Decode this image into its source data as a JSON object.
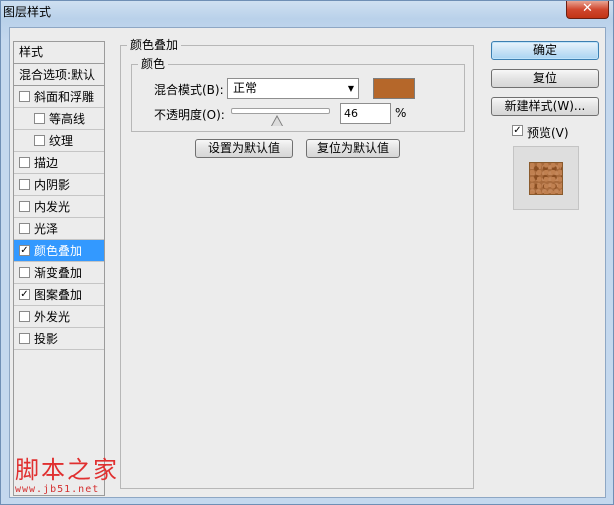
{
  "window": {
    "title": "图层样式",
    "close_glyph": "✕"
  },
  "left_list": {
    "header": "样式",
    "blend_options": "混合选项:默认",
    "items": [
      {
        "label": "斜面和浮雕",
        "checked": false,
        "sub": false,
        "selected": false
      },
      {
        "label": "等高线",
        "checked": false,
        "sub": true,
        "selected": false
      },
      {
        "label": "纹理",
        "checked": false,
        "sub": true,
        "selected": false
      },
      {
        "label": "描边",
        "checked": false,
        "sub": false,
        "selected": false
      },
      {
        "label": "内阴影",
        "checked": false,
        "sub": false,
        "selected": false
      },
      {
        "label": "内发光",
        "checked": false,
        "sub": false,
        "selected": false
      },
      {
        "label": "光泽",
        "checked": false,
        "sub": false,
        "selected": false
      },
      {
        "label": "颜色叠加",
        "checked": true,
        "sub": false,
        "selected": true
      },
      {
        "label": "渐变叠加",
        "checked": false,
        "sub": false,
        "selected": false
      },
      {
        "label": "图案叠加",
        "checked": true,
        "sub": false,
        "selected": false
      },
      {
        "label": "外发光",
        "checked": false,
        "sub": false,
        "selected": false
      },
      {
        "label": "投影",
        "checked": false,
        "sub": false,
        "selected": false
      }
    ]
  },
  "color_overlay": {
    "group_title": "颜色叠加",
    "color_group_title": "颜色",
    "blend_mode_label": "混合模式(B):",
    "blend_mode_value": "正常",
    "overlay_color": "#b5672a",
    "opacity_label": "不透明度(O):",
    "opacity_value": "46",
    "opacity_unit": "%",
    "set_default_button": "设置为默认值",
    "reset_default_button": "复位为默认值"
  },
  "actions": {
    "ok": "确定",
    "reset": "复位",
    "new_style": "新建样式(W)...",
    "preview_label": "预览(V)",
    "preview_checked": true
  },
  "watermark": {
    "logo": "脚本之家",
    "url": "www.jb51.net"
  }
}
